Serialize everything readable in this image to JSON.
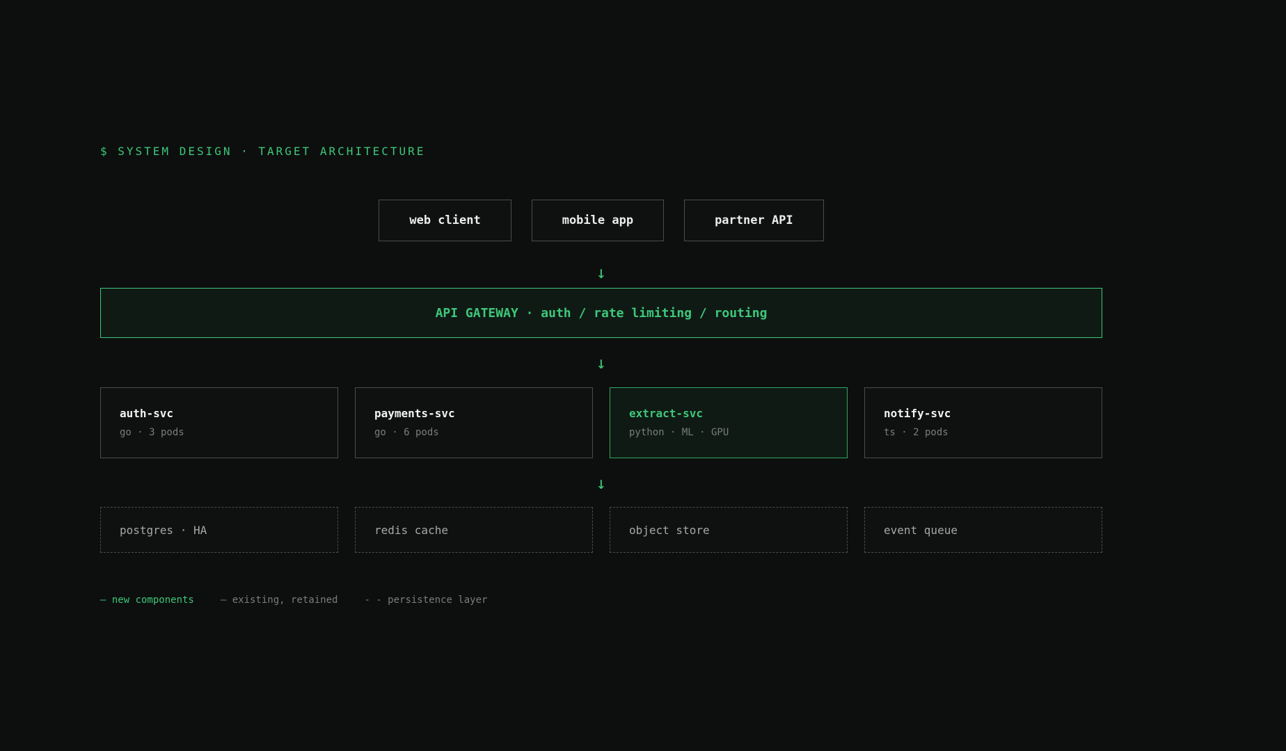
{
  "header": {
    "title": "$ SYSTEM DESIGN · TARGET ARCHITECTURE"
  },
  "clients": [
    {
      "label": "web client"
    },
    {
      "label": "mobile app"
    },
    {
      "label": "partner API"
    }
  ],
  "arrow_glyph": "↓",
  "gateway": {
    "label": "API GATEWAY · auth / rate limiting / routing"
  },
  "services": [
    {
      "name": "auth-svc",
      "meta": "go · 3 pods",
      "status": "existing"
    },
    {
      "name": "payments-svc",
      "meta": "go · 6 pods",
      "status": "existing"
    },
    {
      "name": "extract-svc",
      "meta": "python · ML · GPU",
      "status": "new"
    },
    {
      "name": "notify-svc",
      "meta": "ts · 2 pods",
      "status": "existing"
    }
  ],
  "stores": [
    {
      "label": "postgres · HA"
    },
    {
      "label": "redis cache"
    },
    {
      "label": "object store"
    },
    {
      "label": "event queue"
    }
  ],
  "legend": {
    "new": "— new components",
    "existing": "— existing, retained",
    "persistence": "- - persistence layer"
  },
  "colors": {
    "accent": "#3ec77a",
    "background": "#0d0f0e",
    "border": "#4a4d4b",
    "muted": "#7a7d7b"
  }
}
